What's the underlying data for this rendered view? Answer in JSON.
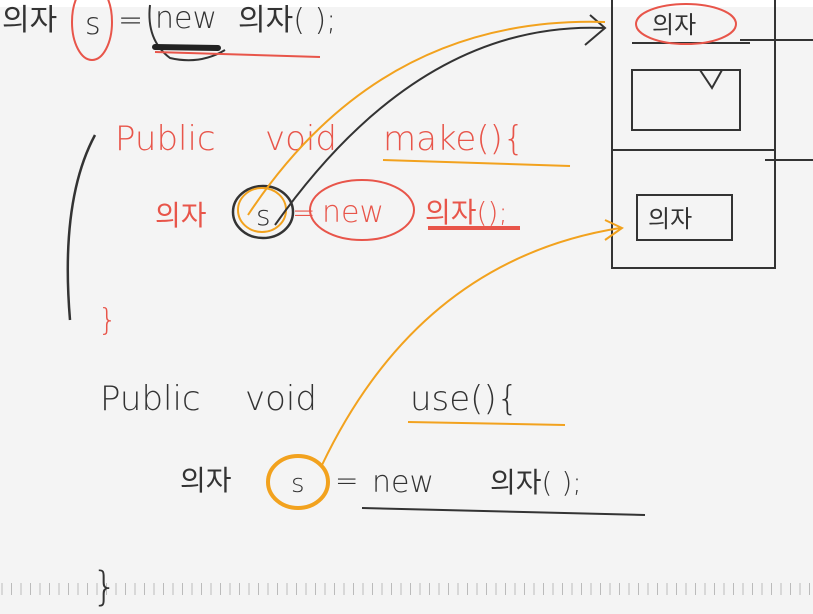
{
  "colors": {
    "ink_dark": "#333333",
    "ink_red": "#e8554a",
    "ink_orange": "#f2a21e",
    "background": "#f4f4f4"
  },
  "code": {
    "line_top": {
      "type": "의자",
      "var": "s",
      "eq": "=",
      "new": "new",
      "ctor": "의자( );"
    },
    "make": {
      "header_public": "Public",
      "header_void": "void",
      "header_name": "make(){",
      "type": "의자",
      "var": "s",
      "eq": "=",
      "new": "new",
      "ctor": "의자();",
      "close": "}"
    },
    "use": {
      "header_public": "Public",
      "header_void": "void",
      "header_name": "use(){",
      "type": "의자",
      "var": "s",
      "eq": "=",
      "new": "new",
      "ctor": "의자( );",
      "close": "}"
    }
  },
  "memory": {
    "top_object": "의자",
    "bottom_object": "의자"
  }
}
